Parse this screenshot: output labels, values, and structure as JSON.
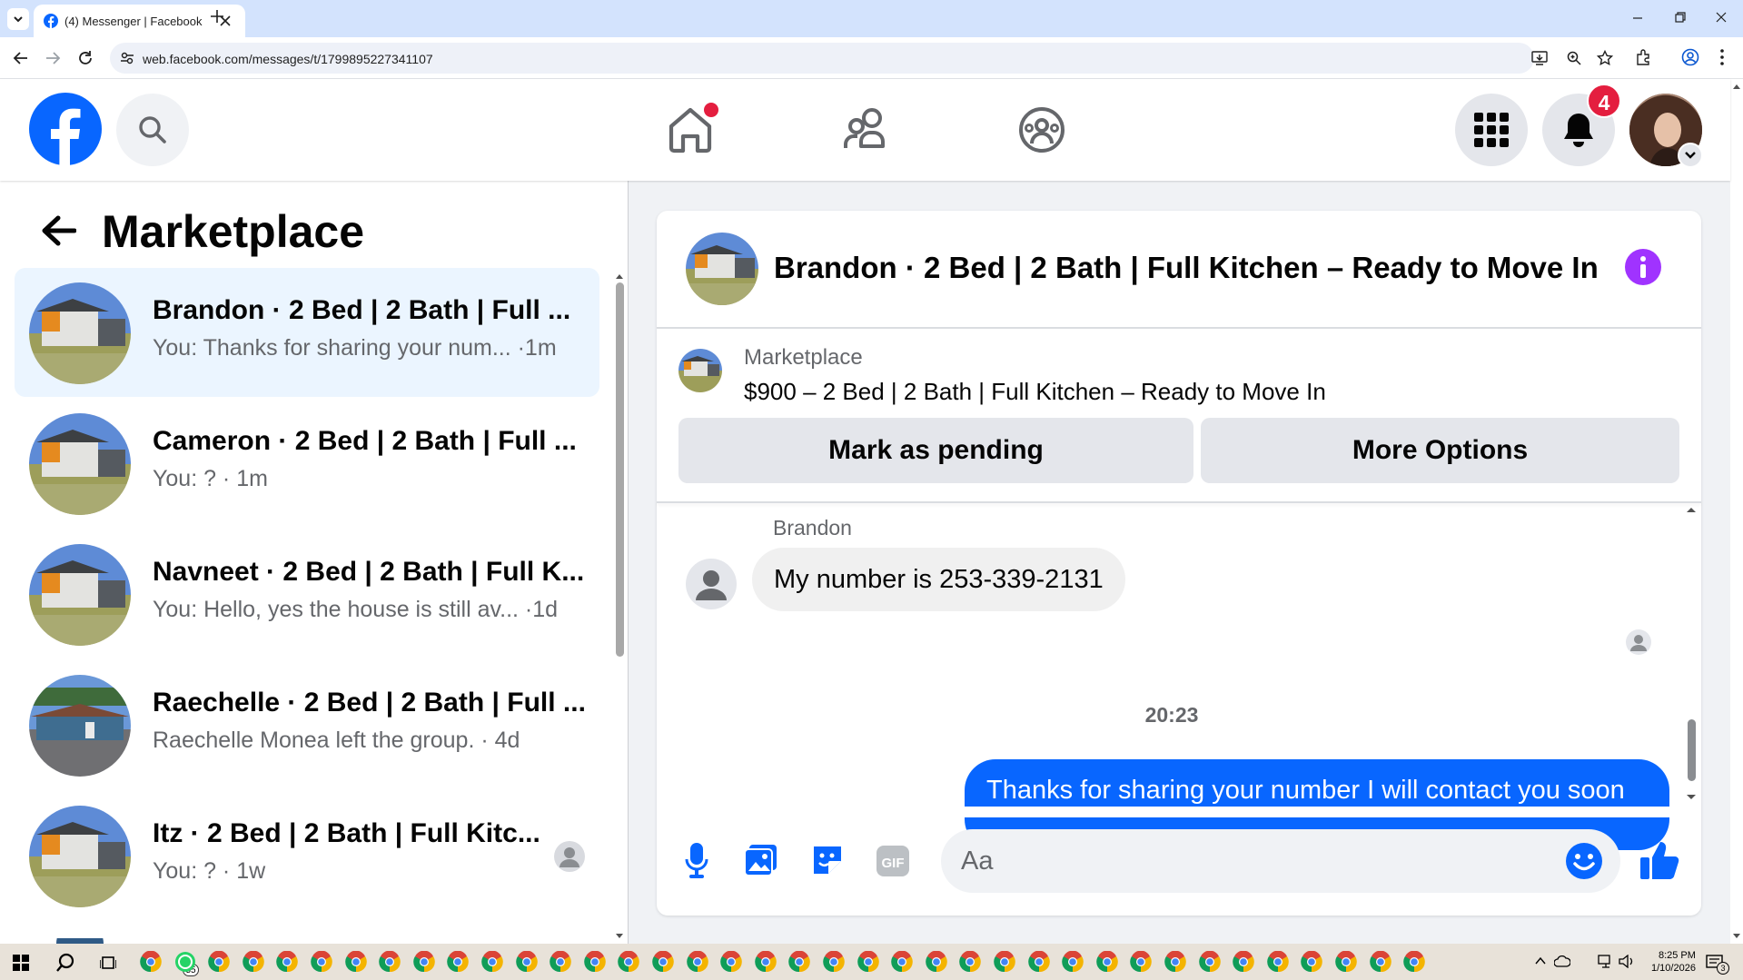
{
  "browser": {
    "tab_title": "(4) Messenger | Facebook",
    "url": "web.facebook.com/messages/t/1799895227341107"
  },
  "header": {
    "notification_count": "4",
    "nav": [
      "home-icon",
      "friends-icon",
      "groups-icon"
    ]
  },
  "left": {
    "title": "Marketplace",
    "conversations": [
      {
        "name": "Brandon · 2 Bed | 2 Bath | Full ...",
        "preview": "You: Thanks for sharing your num... ·1m",
        "active": true
      },
      {
        "name": "Cameron · 2 Bed | 2 Bath | Full ...",
        "preview": "You: ? · 1m"
      },
      {
        "name": "Navneet · 2 Bed | 2 Bath | Full K...",
        "preview": "You: Hello, yes the house is still av... ·1d"
      },
      {
        "name": "Raechelle · 2 Bed | 2 Bath | Full ...",
        "preview": "Raechelle Monea left the group. · 4d"
      },
      {
        "name": "Itz · 2 Bed | 2 Bath | Full Kitc...",
        "preview": "You: ? · 1w"
      }
    ]
  },
  "chat": {
    "title": "Brandon · 2 Bed | 2 Bath | Full Kitchen – Ready to Move In",
    "listing_source": "Marketplace",
    "listing_title": "$900 – 2 Bed | 2 Bath | Full Kitchen – Ready to Move In",
    "mark_pending_label": "Mark as pending",
    "more_options_label": "More Options",
    "sender_name": "Brandon",
    "incoming_message": "My number is 253-339-2131",
    "timestamp": "20:23",
    "outgoing_message": "Thanks for sharing your number I will contact you soon",
    "composer_placeholder": "Aa"
  },
  "taskbar": {
    "time": "8:25 PM",
    "date": "1/10/2026",
    "whatsapp_badge": "55",
    "notification_count": "3"
  },
  "colors": {
    "brand": "#0866ff",
    "accent_purple": "#a033ff",
    "badge_red": "#e41e3f"
  }
}
